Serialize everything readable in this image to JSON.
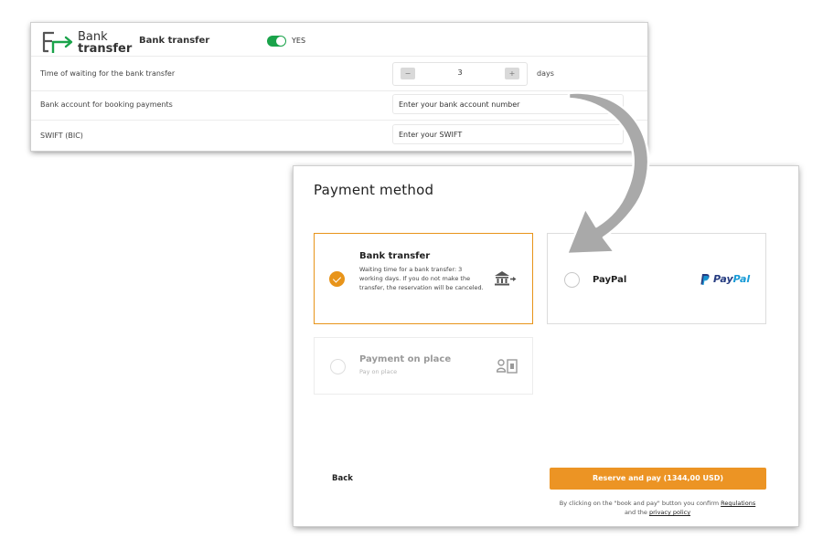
{
  "settings": {
    "logo": {
      "line1": "Bank",
      "line2": "transfer"
    },
    "method_title": "Bank transfer",
    "toggle_label": "YES",
    "wait_label": "Time of waiting for the bank transfer",
    "stepper": {
      "minus": "−",
      "value": "3",
      "plus": "+",
      "unit": "days"
    },
    "account_label": "Bank account for booking payments",
    "account_placeholder": "Enter your bank account number",
    "swift_label": "SWIFT (BIC)",
    "swift_placeholder": "Enter your SWIFT",
    "toggle_color": "#1aa34a"
  },
  "payment": {
    "title": "Payment method",
    "options": [
      {
        "title": "Bank transfer",
        "description": "Waiting time for a bank transfer: 3 working days. If you do not make the transfer, the reservation will be canceled.",
        "selected": true,
        "icon": "bank-icon"
      },
      {
        "title": "PayPal",
        "selected": false,
        "logo_pay": "Pay",
        "logo_pal": "Pal",
        "icon": "paypal-logo"
      },
      {
        "title": "Payment on place",
        "description": "Pay on place",
        "selected": false,
        "icon": "cash-icon"
      }
    ],
    "back_label": "Back",
    "reserve_label": "Reserve and pay (1344,00 USD)",
    "note_prefix": "By clicking on the \"book and pay\" button you confirm",
    "note_link1": "Regulations",
    "note_middle": "and the",
    "note_link2": "privacy policy",
    "accent_color": "#ec9424"
  }
}
